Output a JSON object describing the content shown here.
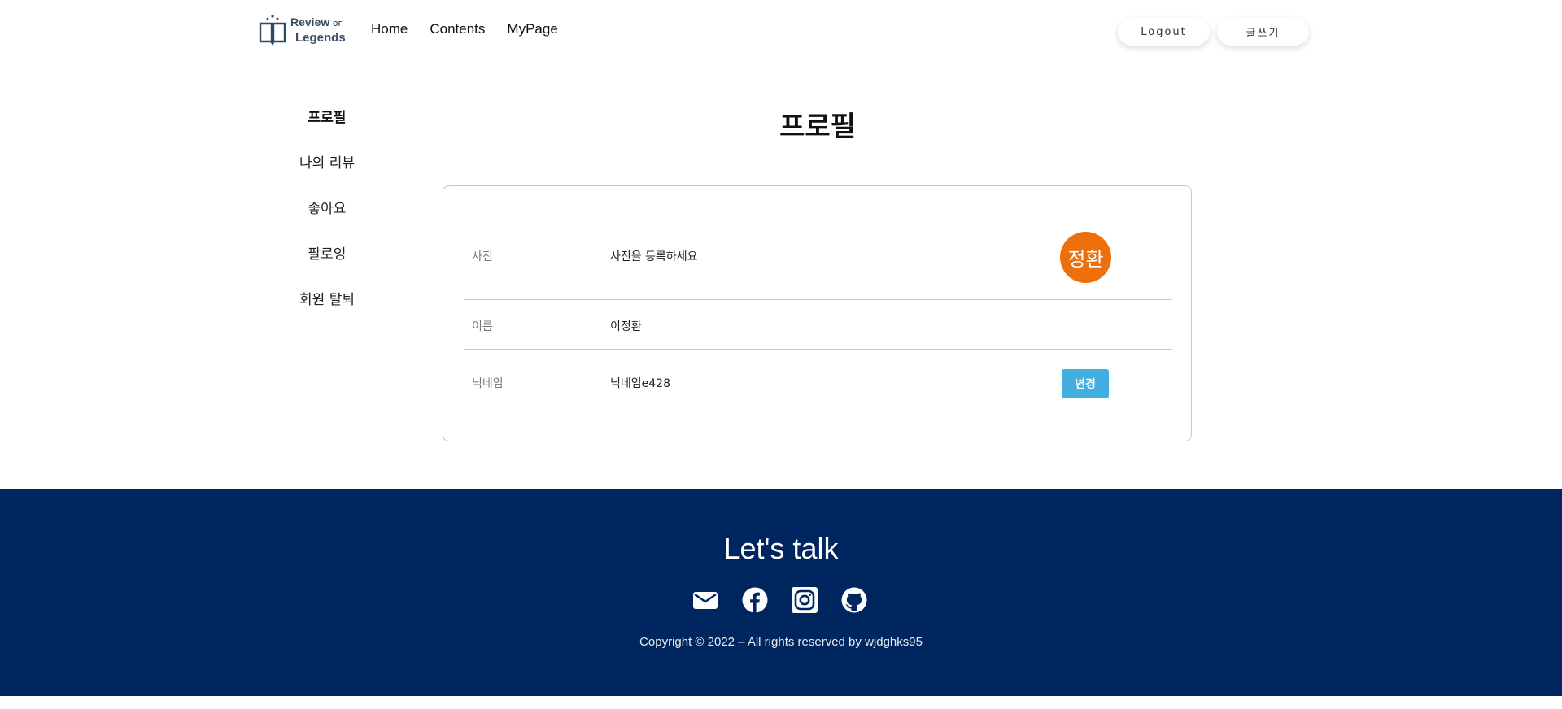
{
  "header": {
    "logo": {
      "line1": "Review",
      "line1_small": "OF",
      "line2": "Legends"
    },
    "nav": [
      "Home",
      "Contents",
      "MyPage"
    ],
    "logout_label": "Logout",
    "write_label": "글쓰기"
  },
  "sidebar": {
    "items": [
      {
        "label": "프로필",
        "active": true
      },
      {
        "label": "나의 리뷰",
        "active": false
      },
      {
        "label": "좋아요",
        "active": false
      },
      {
        "label": "팔로잉",
        "active": false
      },
      {
        "label": "회원 탈퇴",
        "active": false
      }
    ]
  },
  "main": {
    "title": "프로필",
    "rows": {
      "photo": {
        "label": "사진",
        "value": "사진을 등록하세요",
        "avatar_text": "정환"
      },
      "name": {
        "label": "이름",
        "value": "이정환"
      },
      "nickname": {
        "label": "닉네임",
        "value": "닉네임e428",
        "button": "변경"
      }
    }
  },
  "footer": {
    "title": "Let's talk",
    "social_icons": [
      "mail-icon",
      "facebook-icon",
      "instagram-icon",
      "github-icon"
    ],
    "copyright": "Copyright © 2022 – All rights reserved by wjdghks95"
  },
  "colors": {
    "footer_bg": "#002660",
    "avatar_bg": "#ee700d",
    "button_bg": "#41b0e0"
  }
}
